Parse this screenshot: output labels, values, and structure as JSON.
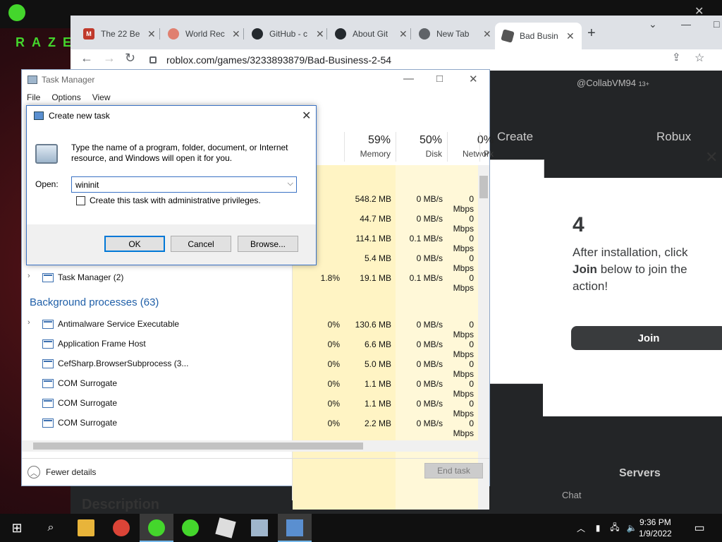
{
  "desktop": {
    "brand": "RAZER"
  },
  "browser": {
    "tabs": [
      {
        "label": "The 22 Be"
      },
      {
        "label": "World Rec"
      },
      {
        "label": "GitHub - c"
      },
      {
        "label": "About Git"
      },
      {
        "label": "New Tab"
      },
      {
        "label": "Bad Busin"
      }
    ],
    "url": "roblox.com/games/3233893879/Bad-Business-2-54"
  },
  "roblox": {
    "user": "@CollabVM94",
    "user_age": "13+",
    "nav_create": "Create",
    "nav_robux": "Robux",
    "step_number": "4",
    "step_text_1": "After installation, click",
    "step_text_bold": "Join",
    "step_text_2": "below to join the action!",
    "join": "Join",
    "servers": "Servers",
    "chat": "Chat",
    "description": "Description"
  },
  "task_manager": {
    "title": "Task Manager",
    "menu": [
      "File",
      "Options",
      "View"
    ],
    "columns": [
      {
        "pct": "59%",
        "name": "Memory"
      },
      {
        "pct": "50%",
        "name": "Disk"
      },
      {
        "pct": "0%",
        "name": "Network"
      },
      {
        "name": "P"
      }
    ],
    "top_rows": [
      {
        "mem": "548.2 MB",
        "disk": "0 MB/s",
        "net": "0 Mbps"
      },
      {
        "mem": "44.7 MB",
        "disk": "0 MB/s",
        "net": "0 Mbps"
      },
      {
        "mem": "114.1 MB",
        "disk": "0.1 MB/s",
        "net": "0 Mbps"
      },
      {
        "mem": "5.4 MB",
        "disk": "0 MB/s",
        "net": "0 Mbps"
      }
    ],
    "task_manager_row": {
      "name": "Task Manager (2)",
      "cpu": "1.8%",
      "mem": "19.1 MB",
      "disk": "0.1 MB/s",
      "net": "0 Mbps"
    },
    "background_header": "Background processes (63)",
    "bg_rows": [
      {
        "name": "Antimalware Service Executable",
        "cpu": "0%",
        "mem": "130.6 MB",
        "disk": "0 MB/s",
        "net": "0 Mbps"
      },
      {
        "name": "Application Frame Host",
        "cpu": "0%",
        "mem": "6.6 MB",
        "disk": "0 MB/s",
        "net": "0 Mbps"
      },
      {
        "name": "CefSharp.BrowserSubprocess (3...",
        "cpu": "0%",
        "mem": "5.0 MB",
        "disk": "0 MB/s",
        "net": "0 Mbps"
      },
      {
        "name": "COM Surrogate",
        "cpu": "0%",
        "mem": "1.1 MB",
        "disk": "0 MB/s",
        "net": "0 Mbps"
      },
      {
        "name": "COM Surrogate",
        "cpu": "0%",
        "mem": "1.1 MB",
        "disk": "0 MB/s",
        "net": "0 Mbps"
      },
      {
        "name": "COM Surrogate",
        "cpu": "0%",
        "mem": "2.2 MB",
        "disk": "0 MB/s",
        "net": "0 Mbps"
      }
    ],
    "fewer_details": "Fewer details",
    "end_task": "End task"
  },
  "dialog": {
    "title": "Create new task",
    "message": "Type the name of a program, folder, document, or Internet resource, and Windows will open it for you.",
    "open_label": "Open:",
    "open_value": "wininit",
    "admin_label": "Create this task with administrative privileges.",
    "ok": "OK",
    "cancel": "Cancel",
    "browse": "Browse..."
  },
  "taskbar": {
    "time": "9:36 PM",
    "date": "1/9/2022"
  }
}
